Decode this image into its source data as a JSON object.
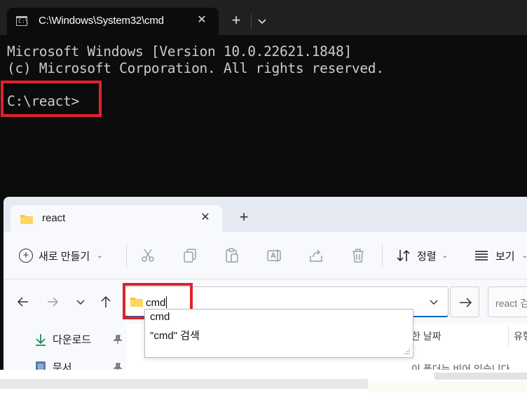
{
  "terminal": {
    "tab_title": "C:\\Windows\\System32\\cmd",
    "lines": [
      "Microsoft Windows [Version 10.0.22621.1848]",
      "(c) Microsoft Corporation. All rights reserved.",
      "C:\\react>"
    ],
    "close_glyph": "✕",
    "new_tab_glyph": "+",
    "icon_glyph": "C:\\"
  },
  "explorer": {
    "tab_title": "react",
    "close_glyph": "✕",
    "new_tab_glyph": "+",
    "toolbar": {
      "new_label": "새로 만들기",
      "sort_label": "정렬",
      "view_label": "보기"
    },
    "address": {
      "value": "cmd"
    },
    "search": {
      "placeholder": "react 검색"
    },
    "suggestions": [
      "cmd",
      "\"cmd\" 검색"
    ],
    "nav_pane": [
      {
        "label": "다운로드"
      },
      {
        "label": "문서"
      }
    ],
    "columns": [
      "한 날짜",
      "유형"
    ],
    "empty_message": "이 폴더는 비어 있습니다"
  },
  "colors": {
    "highlight": "#e0222b",
    "terminal_bg": "#0c0c0c",
    "accent": "#0067c0"
  }
}
